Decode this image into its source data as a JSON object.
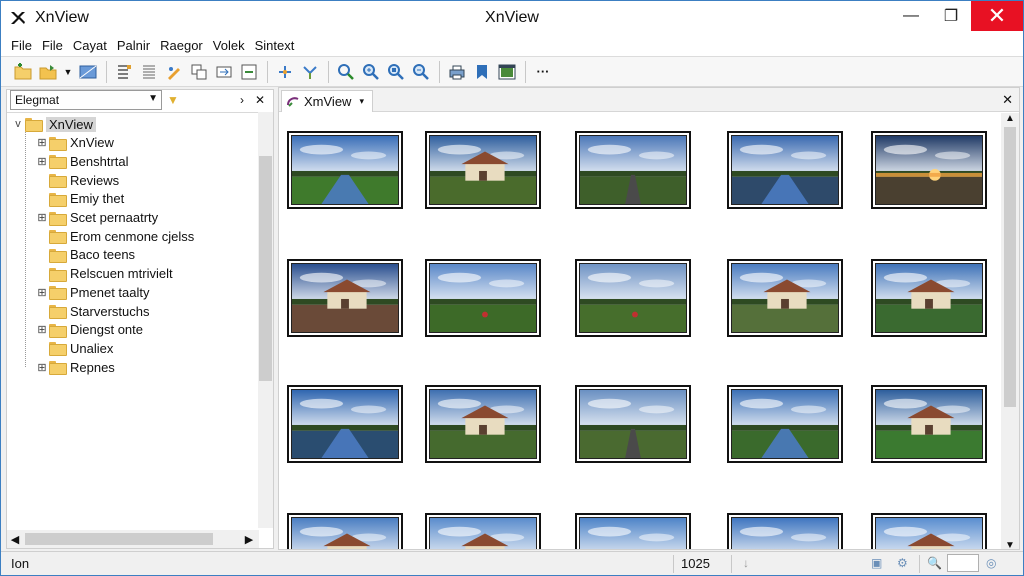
{
  "window": {
    "title_left": "XnView",
    "title_center": "XnView",
    "controls": {
      "minimize": "—",
      "maximize": "❐",
      "close": "✕"
    }
  },
  "menu": [
    "File",
    "File",
    "Cayat",
    "Palnir",
    "Raegor",
    "Volek",
    "Sintext"
  ],
  "toolbar": {
    "icons": [
      "open-folder-icon",
      "open-file-icon",
      "dropdown-arrow-icon",
      "browse-icon",
      "list-icon",
      "details-icon",
      "edit-icon",
      "copy-icon",
      "move-icon",
      "convert-icon",
      "add-icon",
      "tools-icon",
      "search-icon",
      "zoom-in-icon",
      "zoom-fit-icon",
      "zoom-out-icon",
      "print-icon",
      "bookmark-icon",
      "slideshow-icon",
      "more-icon"
    ]
  },
  "left_panel": {
    "path_value": "Elegmat",
    "nav": {
      "forward": "›",
      "close": "✕"
    },
    "tree": [
      {
        "label": "XnView",
        "level": 0,
        "expander": "v",
        "selected": true
      },
      {
        "label": "XnView",
        "level": 1,
        "expander": "⊞"
      },
      {
        "label": "Benshtrtal",
        "level": 1,
        "expander": "⊞"
      },
      {
        "label": "Reviews",
        "level": 1,
        "expander": ""
      },
      {
        "label": "Emiy thet",
        "level": 1,
        "expander": ""
      },
      {
        "label": "Scet pernaatrty",
        "level": 1,
        "expander": "⊞"
      },
      {
        "label": "Erom cenmone cjelss",
        "level": 1,
        "expander": ""
      },
      {
        "label": "Baco teens",
        "level": 1,
        "expander": ""
      },
      {
        "label": "Relscuen mtrivielt",
        "level": 1,
        "expander": ""
      },
      {
        "label": "Pmenet taalty",
        "level": 1,
        "expander": "⊞"
      },
      {
        "label": "Starverstuchs",
        "level": 1,
        "expander": ""
      },
      {
        "label": "Diengst onte",
        "level": 1,
        "expander": "⊞"
      },
      {
        "label": "Unaliex",
        "level": 1,
        "expander": ""
      },
      {
        "label": "Repnes",
        "level": 1,
        "expander": "⊞"
      }
    ]
  },
  "right_panel": {
    "tab_label": "XmView",
    "tab_arrow": "▾",
    "close": "✕"
  },
  "thumbnails": [
    {
      "scene": "canal",
      "sky": "#3a6fb8",
      "ground": "#3f7a2c"
    },
    {
      "scene": "house",
      "sky": "#2f5f9e",
      "ground": "#4a6b2c"
    },
    {
      "scene": "road",
      "sky": "#4c78b8",
      "ground": "#3e5f2a"
    },
    {
      "scene": "lake",
      "sky": "#3a6ab0",
      "ground": "#2e4a6a"
    },
    {
      "scene": "sunset",
      "sky": "#203a66",
      "ground": "#4a4030"
    },
    {
      "scene": "station",
      "sky": "#2a4f8f",
      "ground": "#6a4a38"
    },
    {
      "scene": "field",
      "sky": "#5a88c8",
      "ground": "#3d6a28"
    },
    {
      "scene": "field",
      "sky": "#6f93c4",
      "ground": "#466e2c"
    },
    {
      "scene": "house",
      "sky": "#4a7cc0",
      "ground": "#55703a"
    },
    {
      "scene": "house",
      "sky": "#3f73b8",
      "ground": "#3a6a30"
    },
    {
      "scene": "lake",
      "sky": "#2f66b0",
      "ground": "#2a4d70"
    },
    {
      "scene": "house",
      "sky": "#3e6fb0",
      "ground": "#456a2e"
    },
    {
      "scene": "road",
      "sky": "#6a90c2",
      "ground": "#4a6a30"
    },
    {
      "scene": "canal",
      "sky": "#3b70b6",
      "ground": "#3a6a2c"
    },
    {
      "scene": "house",
      "sky": "#2d5e9c",
      "ground": "#3b7a30"
    },
    {
      "scene": "house",
      "sky": "#4a7ec2",
      "ground": "#c8b890"
    },
    {
      "scene": "house",
      "sky": "#5a8ccc",
      "ground": "#a89070"
    },
    {
      "scene": "road",
      "sky": "#4e84c8",
      "ground": "#5a6a3a"
    },
    {
      "scene": "road",
      "sky": "#3f76c0",
      "ground": "#6a6a50"
    },
    {
      "scene": "house",
      "sky": "#5a8ed0",
      "ground": "#b0a080"
    }
  ],
  "status": {
    "left_text": "Ion",
    "count": "1025"
  }
}
